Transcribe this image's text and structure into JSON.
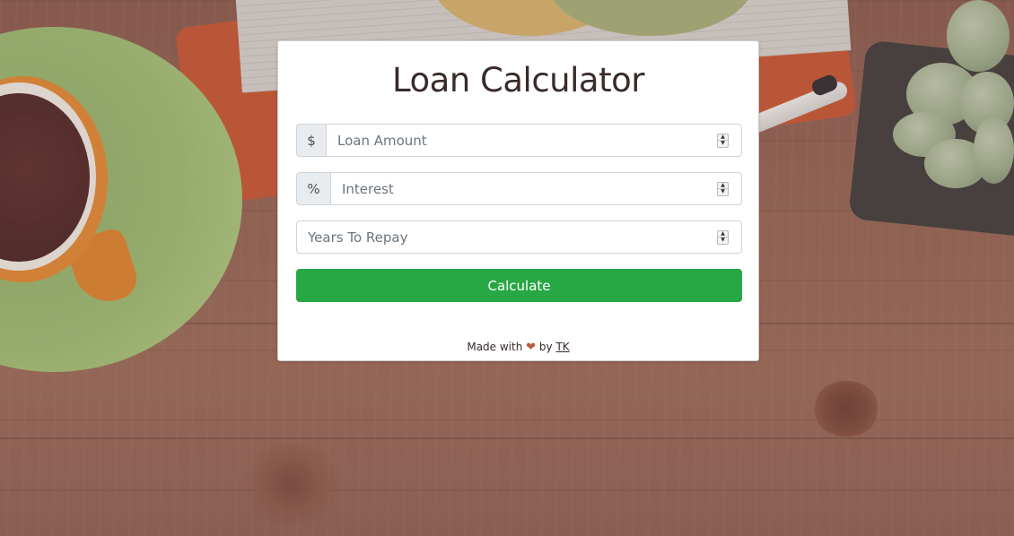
{
  "title": "Loan Calculator",
  "fields": {
    "amount": {
      "addon": "$",
      "placeholder": "Loan Amount",
      "value": ""
    },
    "interest": {
      "addon": "%",
      "placeholder": "Interest",
      "value": ""
    },
    "years": {
      "placeholder": "Years To Repay",
      "value": ""
    }
  },
  "calculate_label": "Calculate",
  "footer": {
    "prefix": "Made with",
    "heart": "❤",
    "by": "by",
    "author": "TK"
  },
  "colors": {
    "button": "#28a745",
    "heart": "#b85a3c",
    "title": "#3a2a2a"
  }
}
